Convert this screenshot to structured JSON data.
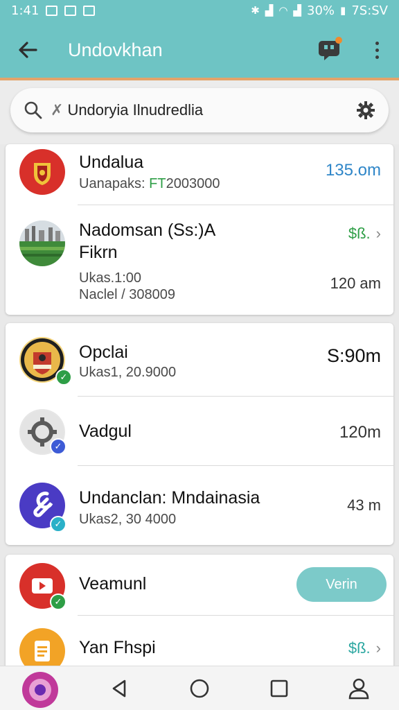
{
  "status_bar": {
    "time": "1:41",
    "battery": "30%",
    "clock": "7S:SV"
  },
  "app_bar": {
    "title": "Undovkhan"
  },
  "search": {
    "query": "Undoryia Ilnudredlia"
  },
  "colors": {
    "teal": "#6ec4c4",
    "accent_blue": "#2f86c8",
    "accent_green": "#2e9e46",
    "orange": "#f08a2c"
  },
  "card1": {
    "rows": [
      {
        "title": "Undalua",
        "sub_prefix": "Uanapaks: ",
        "sub_highlight": "FT",
        "sub_rest": "2003000",
        "value": "135.om"
      },
      {
        "title_line1": "Nadomsan (Ss:)A",
        "title_line2": "Fikrn",
        "sub_line1": "Ukas.1:00",
        "sub_line2": "Naclel / 308009",
        "value_top": "$ß.",
        "value": "120 am"
      }
    ]
  },
  "card2": {
    "rows": [
      {
        "title": "Opclai",
        "sub": "Ukas1, 20.9000",
        "value": "S:90m"
      },
      {
        "title": "Vadgul",
        "value": "120m"
      },
      {
        "title": "Undanclan: Mndainasia",
        "sub": "Ukas2, 30 4000",
        "value": "43 m"
      }
    ]
  },
  "card3": {
    "rows": [
      {
        "title": "Veamunl",
        "button": "Verin"
      },
      {
        "title": "Yan Fhspi",
        "value": "$ß."
      }
    ]
  },
  "nav": {
    "icons": [
      "app-launcher-icon",
      "back-icon",
      "home-icon",
      "recents-icon",
      "profile-icon"
    ]
  }
}
